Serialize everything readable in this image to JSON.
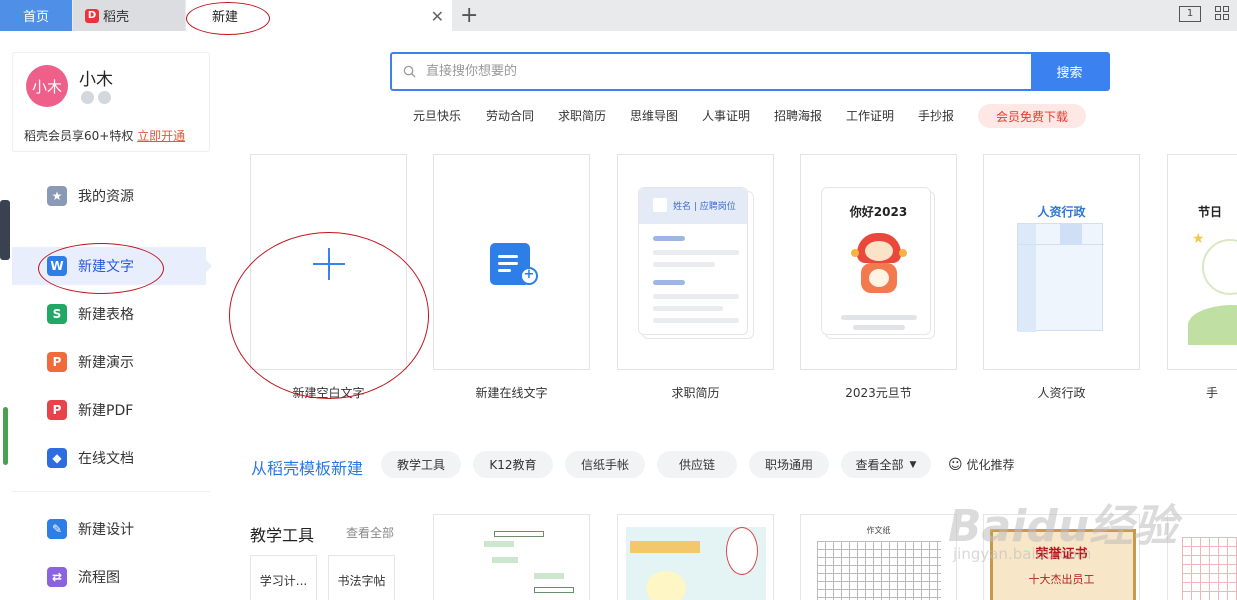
{
  "tabs": {
    "home": "首页",
    "daoke": "稻壳",
    "new": "新建",
    "logo_glyph": "D"
  },
  "window": {
    "badge": "1"
  },
  "user": {
    "avatar_text": "小木",
    "name": "小木",
    "vip_text": "稻壳会员享60+特权",
    "vip_link": "立即开通"
  },
  "nav": [
    {
      "label": "我的资源",
      "icon": "star-icon",
      "color": "#8a9ab5",
      "glyph": "★"
    },
    {
      "label": "新建文字",
      "icon": "word-icon",
      "color": "#2e7ee8",
      "glyph": "W"
    },
    {
      "label": "新建表格",
      "icon": "sheet-icon",
      "color": "#20a866",
      "glyph": "S"
    },
    {
      "label": "新建演示",
      "icon": "presentation-icon",
      "color": "#ef6b3a",
      "glyph": "P"
    },
    {
      "label": "新建PDF",
      "icon": "pdf-icon",
      "color": "#e8434b",
      "glyph": "P"
    },
    {
      "label": "在线文档",
      "icon": "cloud-doc-icon",
      "color": "#2d6de0",
      "glyph": "◆"
    },
    {
      "label": "新建设计",
      "icon": "design-icon",
      "color": "#2e7ee8",
      "glyph": "✎"
    },
    {
      "label": "流程图",
      "icon": "flowchart-icon",
      "color": "#8a64e0",
      "glyph": "⇄"
    }
  ],
  "search": {
    "placeholder": "直接搜你想要的",
    "button": "搜索"
  },
  "hotwords": [
    "元旦快乐",
    "劳动合同",
    "求职简历",
    "思维导图",
    "人事证明",
    "招聘海报",
    "工作证明",
    "手抄报"
  ],
  "vip_download": "会员免费下载",
  "cards": [
    {
      "label": "新建空白文字"
    },
    {
      "label": "新建在线文字"
    },
    {
      "label": "求职简历",
      "thumb_text": "姓名 | 应聘岗位"
    },
    {
      "label": "2023元旦节",
      "thumb_text": "你好2023"
    },
    {
      "label": "人资行政",
      "thumb_text": "人资行政"
    },
    {
      "label": "手",
      "thumb_text": "节日"
    }
  ],
  "templates": {
    "title": "从稻壳模板新建",
    "chips": [
      "教学工具",
      "K12教育",
      "信纸手帐",
      "供应链",
      "职场通用",
      "查看全部"
    ],
    "recommend": "优化推荐"
  },
  "section": {
    "title": "教学工具",
    "more": "查看全部",
    "items": [
      "学习计...",
      "书法字帖"
    ]
  },
  "thumbs": {
    "award": "荣誉证书",
    "award_sub": "十大杰出员工",
    "grid_title": "作文纸"
  },
  "watermark": {
    "main": "Baidu经验",
    "sub": "jingyan.baidu.com"
  },
  "colors": {
    "accent": "#3b82f0",
    "tab_active": "#4f8fe8",
    "annotation": "#c0141b"
  }
}
